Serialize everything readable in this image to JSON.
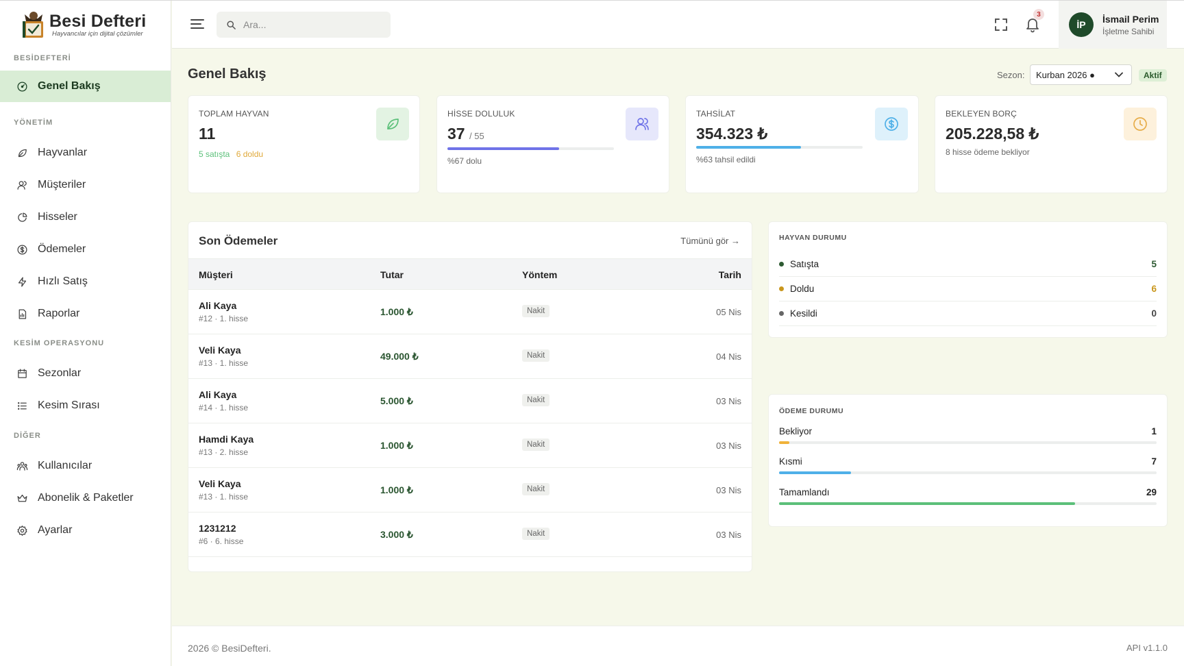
{
  "brand": {
    "name": "Besi Defteri",
    "tagline": "Hayvancılar için dijital çözümler"
  },
  "sidebar": {
    "sections": [
      {
        "title": "BESİDEFTERİ"
      },
      {
        "title": "YÖNETİM"
      },
      {
        "title": "KESİM OPERASYONU"
      },
      {
        "title": "DİĞER"
      }
    ],
    "items": [
      {
        "label": "Genel Bakış",
        "icon": "dashboard-icon"
      },
      {
        "label": "Hayvanlar",
        "icon": "leaf-icon"
      },
      {
        "label": "Müşteriler",
        "icon": "users-icon"
      },
      {
        "label": "Hisseler",
        "icon": "pie-chart-icon"
      },
      {
        "label": "Ödemeler",
        "icon": "dollar-icon"
      },
      {
        "label": "Hızlı Satış",
        "icon": "bolt-icon"
      },
      {
        "label": "Raporlar",
        "icon": "report-icon"
      },
      {
        "label": "Sezonlar",
        "icon": "calendar-icon"
      },
      {
        "label": "Kesim Sırası",
        "icon": "list-icon"
      },
      {
        "label": "Kullanıcılar",
        "icon": "user-group-icon"
      },
      {
        "label": "Abonelik & Paketler",
        "icon": "crown-icon"
      },
      {
        "label": "Ayarlar",
        "icon": "gear-icon"
      }
    ]
  },
  "topbar": {
    "search_placeholder": "Ara...",
    "notification_count": "3",
    "user": {
      "initials": "İP",
      "name": "İsmail Perim",
      "role": "İşletme Sahibi"
    }
  },
  "page": {
    "title": "Genel Bakış",
    "season_label": "Sezon:",
    "season_value": "Kurban 2026 ●",
    "season_status": "Aktif"
  },
  "cards": {
    "animals": {
      "label": "TOPLAM HAYVAN",
      "value": "11",
      "sub_sale": "5 satışta",
      "sub_full": "6 doldu"
    },
    "shares": {
      "label": "HİSSE DOLULUK",
      "value": "37",
      "total": "/ 55",
      "sub": "%67 dolu",
      "progress": 0.67
    },
    "collection": {
      "label": "TAHSİLAT",
      "value": "354.323 ₺",
      "sub": "%63 tahsil edildi",
      "progress": 0.63
    },
    "debt": {
      "label": "BEKLEYEN BORÇ",
      "value": "205.228,58 ₺",
      "sub": "8 hisse ödeme bekliyor"
    }
  },
  "payments": {
    "title": "Son Ödemeler",
    "see_all": "Tümünü gör →",
    "columns": [
      "Müşteri",
      "Tutar",
      "Yöntem",
      "Tarih"
    ],
    "rows": [
      {
        "name": "Ali Kaya",
        "ref": "#12 · 1. hisse",
        "amount": "1.000 ₺",
        "method": "Nakit",
        "date": "05 Nis"
      },
      {
        "name": "Veli Kaya",
        "ref": "#13 · 1. hisse",
        "amount": "49.000 ₺",
        "method": "Nakit",
        "date": "04 Nis"
      },
      {
        "name": "Ali Kaya",
        "ref": "#14 · 1. hisse",
        "amount": "5.000 ₺",
        "method": "Nakit",
        "date": "03 Nis"
      },
      {
        "name": "Hamdi Kaya",
        "ref": "#13 · 2. hisse",
        "amount": "1.000 ₺",
        "method": "Nakit",
        "date": "03 Nis"
      },
      {
        "name": "Veli Kaya",
        "ref": "#13 · 1. hisse",
        "amount": "1.000 ₺",
        "method": "Nakit",
        "date": "03 Nis"
      },
      {
        "name": "1231212",
        "ref": "#6 · 6. hisse",
        "amount": "3.000 ₺",
        "method": "Nakit",
        "date": "03 Nis"
      }
    ]
  },
  "animal_status": {
    "title": "HAYVAN DURUMU",
    "items": [
      {
        "label": "Satışta",
        "value": "5",
        "color": "#2d5a32"
      },
      {
        "label": "Doldu",
        "value": "6",
        "color": "#c9961d"
      },
      {
        "label": "Kesildi",
        "value": "0",
        "color": "#666666"
      }
    ]
  },
  "payment_status": {
    "title": "ÖDEME DURUMU",
    "items": [
      {
        "label": "Bekliyor",
        "value": "1",
        "fraction": 0.027,
        "color": "#f0b23a"
      },
      {
        "label": "Kısmi",
        "value": "7",
        "fraction": 0.19,
        "color": "#4fb0e8"
      },
      {
        "label": "Tamamlandı",
        "value": "29",
        "fraction": 0.784,
        "color": "#5cc07a"
      }
    ]
  },
  "footer": {
    "copyright": "2026 © BesiDefteri.",
    "version": "API v1.1.0"
  },
  "colors": {
    "accent": "#1f4a2a",
    "active_bg": "#d9edd5",
    "page_bg": "#f6f8ea"
  }
}
